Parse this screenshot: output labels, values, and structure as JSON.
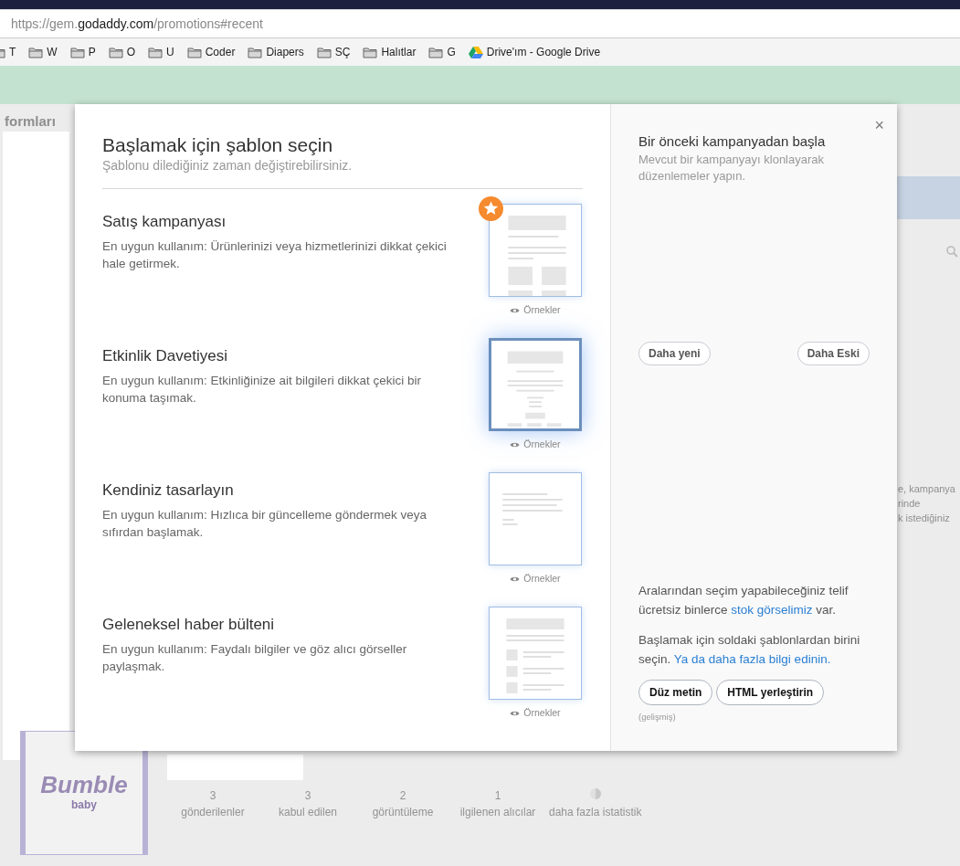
{
  "browser": {
    "url": {
      "prefix": "https://gem.",
      "domain": "godaddy.com",
      "path": "/promotions#recent"
    },
    "bookmarks": [
      {
        "label": "T",
        "kind": "folder"
      },
      {
        "label": "W",
        "kind": "folder"
      },
      {
        "label": "P",
        "kind": "folder"
      },
      {
        "label": "O",
        "kind": "folder"
      },
      {
        "label": "U",
        "kind": "folder"
      },
      {
        "label": "Coder",
        "kind": "folder"
      },
      {
        "label": "Diapers",
        "kind": "folder"
      },
      {
        "label": "SÇ",
        "kind": "folder"
      },
      {
        "label": "Halıtlar",
        "kind": "folder"
      },
      {
        "label": "G",
        "kind": "folder"
      },
      {
        "label": "Drive'ım - Google Drive",
        "kind": "drive"
      }
    ]
  },
  "background": {
    "section_title": "formları",
    "side_texts": [
      "e, kampanya",
      "rinde",
      "k istediğiniz"
    ],
    "stats": [
      {
        "value": "3",
        "label": "gönderilenler",
        "kind": "number"
      },
      {
        "value": "3",
        "label": "kabul edilen",
        "kind": "number"
      },
      {
        "value": "2",
        "label": "görüntüleme",
        "kind": "number"
      },
      {
        "value": "1",
        "label": "ilgilenen alıcılar",
        "kind": "number"
      },
      {
        "label": "daha fazla istatistik",
        "kind": "pie"
      }
    ],
    "logo": {
      "name": "Bumble",
      "sub": "baby"
    }
  },
  "modal": {
    "title": "Başlamak için şablon seçin",
    "subtitle": "Şablonu dilediğiniz zaman değiştirebilirsiniz.",
    "templates": [
      {
        "title": "Satış kampanyası",
        "description": "En uygun kullanım: Ürünlerinizi veya hizmetlerinizi dikkat çekici hale getirmek.",
        "kind": "sale",
        "featured": true,
        "selected": false,
        "examples": "Örnekler"
      },
      {
        "title": "Etkinlik Davetiyesi",
        "description": "En uygun kullanım: Etkinliğinize ait bilgileri dikkat çekici bir konuma taşımak.",
        "kind": "event",
        "featured": false,
        "selected": true,
        "examples": "Örnekler"
      },
      {
        "title": "Kendiniz tasarlayın",
        "description": "En uygun kullanım: Hızlıca bir güncelleme göndermek veya sıfırdan başlamak.",
        "kind": "custom",
        "featured": false,
        "selected": false,
        "examples": "Örnekler"
      },
      {
        "title": "Geleneksel haber bülteni",
        "description": "En uygun kullanım: Faydalı bilgiler ve göz alıcı görseller paylaşmak.",
        "kind": "newsletter",
        "featured": false,
        "selected": false,
        "examples": "Örnekler"
      }
    ],
    "side": {
      "close": "×",
      "title": "Bir önceki kampanyadan başla",
      "subtitle": "Mevcut bir kampanyayı klonlayarak düzenlemeler yapın.",
      "nav_buttons": [
        "Daha yeni",
        "Daha Eski"
      ],
      "stock_text": [
        {
          "text": "Aralarından seçim yapabileceğiniz telif ücretsiz binlerce ",
          "link": false
        },
        {
          "text": "stok görselimiz",
          "link": true
        },
        {
          "text": " var.",
          "link": false
        }
      ],
      "start_text": [
        {
          "text": "Başlamak için soldaki şablonlardan birini seçin. ",
          "link": false
        },
        {
          "text": "Ya da daha fazla bilgi edinin.",
          "link": true
        }
      ],
      "buttons": [
        "Düz metin",
        "HTML yerleştirin"
      ],
      "note": "(gelişmiş)"
    }
  }
}
